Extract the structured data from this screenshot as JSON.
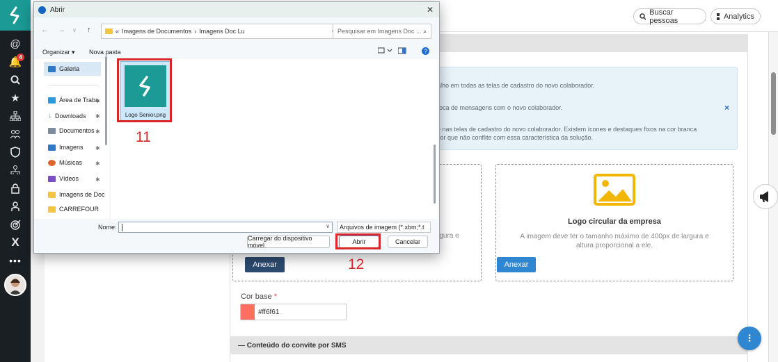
{
  "colors": {
    "rail": "#1a1f24",
    "brand": "#1b9a96",
    "accent_button": "#2f86d1",
    "attach_dark": "#2c4b6e",
    "base_color_swatch": "#ff6f61",
    "highlight": "#d9262b"
  },
  "rail": {
    "notifications_count": "4",
    "icons": [
      "at-icon",
      "bell-icon",
      "search-icon",
      "star-icon",
      "org-chart-icon",
      "people-icon",
      "shield-icon",
      "org-icon",
      "lock-icon",
      "person-pin-icon",
      "target-icon",
      "close-icon",
      "more-icon"
    ],
    "more_label": "•••"
  },
  "topbar": {
    "search_people": "Buscar pessoas",
    "analytics": "Analytics"
  },
  "background_form": {
    "info_lines": [
      "alho em todas as telas de cadastro do novo colaborador.",
      "roca de mensagens com o novo colaborador.",
      "e nas telas de cadastro do novo colaborador. Existem ícones e destaques fixos na cor branca",
      "cor que não conflite com essa característica da solução."
    ],
    "close_glyph": "×",
    "logo_left_partial": "rgura e",
    "logo_circular_title": "Logo circular da empresa",
    "logo_circular_desc": "A imagem deve ter o tamanho máximo de 400px de largura e altura proporcional a ele.",
    "attach_label": "Anexar",
    "attach_label_2": "Anexar",
    "base_color_label": "Cor base",
    "required_mark": "*",
    "base_color_value": "#ff6f61",
    "sms_section": "— Conteúdo do convite por SMS",
    "fab_label": "⋮"
  },
  "dialog": {
    "title": "Abrir",
    "close": "✕",
    "breadcrumb_prefix": "«",
    "breadcrumb_1": "Imagens de Documentos",
    "breadcrumb_sep": "›",
    "breadcrumb_2": "Imagens Doc Lu",
    "search_placeholder": "Pesquisar em Imagens Doc ...",
    "organize": "Organizar ▾",
    "new_folder": "Nova pasta",
    "nav_items": [
      {
        "label": "Galeria",
        "icon": "gallery-icon",
        "color": "#2f78c9",
        "selected": true
      },
      {
        "label": "Área de Traba",
        "icon": "desktop-icon",
        "color": "#2f9ad9",
        "pinned": true
      },
      {
        "label": "Downloads",
        "icon": "download-icon",
        "color": "#2a7fd4",
        "pinned": true
      },
      {
        "label": "Documentos",
        "icon": "documents-icon",
        "color": "#7c8da0",
        "pinned": true
      },
      {
        "label": "Imagens",
        "icon": "images-icon",
        "color": "#2f78c9",
        "pinned": true
      },
      {
        "label": "Músicas",
        "icon": "music-icon",
        "color": "#e0642c",
        "pinned": true
      },
      {
        "label": "Vídeos",
        "icon": "videos-icon",
        "color": "#7a4fc7",
        "pinned": true
      },
      {
        "label": "Imagens de Doc",
        "icon": "folder-icon",
        "color": "#f4c542"
      },
      {
        "label": "CARREFOUR",
        "icon": "folder-icon",
        "color": "#f4c542"
      }
    ],
    "file_name": "Logo Senior.png",
    "name_label": "Nome:",
    "file_type": "Arquivos de imagem (*.xbm;*.t",
    "upload_from_device": "Carregar do dispositivo móvel",
    "open": "Abrir",
    "cancel": "Cancelar"
  },
  "annotations": {
    "step_11": "11",
    "step_12": "12"
  }
}
